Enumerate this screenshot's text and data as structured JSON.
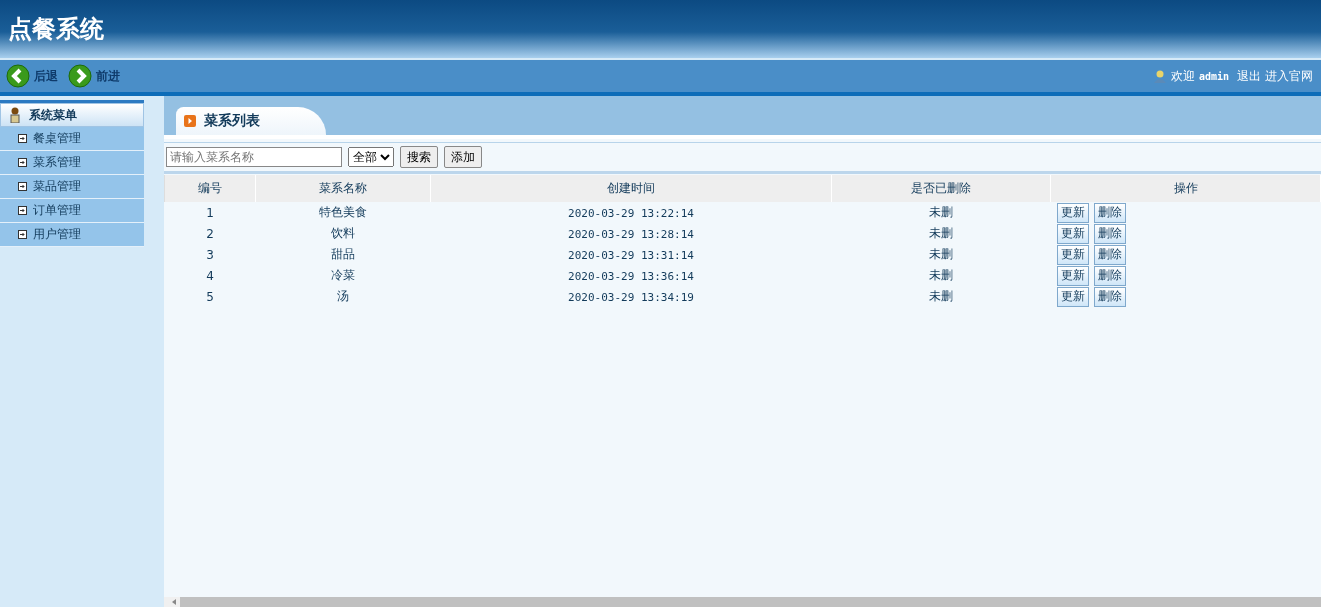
{
  "header": {
    "title": "点餐系统"
  },
  "nav": {
    "back": "后退",
    "forward": "前进",
    "welcome": "欢迎",
    "user": "admin",
    "logout": "退出",
    "site": "进入官网"
  },
  "sidebar": {
    "title": "系统菜单",
    "items": [
      {
        "label": "餐桌管理"
      },
      {
        "label": "菜系管理"
      },
      {
        "label": "菜品管理"
      },
      {
        "label": "订单管理"
      },
      {
        "label": "用户管理"
      }
    ]
  },
  "tab": {
    "label": "菜系列表"
  },
  "toolbar": {
    "search": {
      "placeholder": "请输入菜系名称"
    },
    "filter": {
      "value": "全部"
    },
    "buttons": [
      "搜索",
      "添加"
    ]
  },
  "table": {
    "columns": [
      "编号",
      "菜系名称",
      "创建时间",
      "是否已删除",
      "操作"
    ],
    "rows": [
      {
        "id": "1",
        "name": "特色美食",
        "created": "2020-03-29 13:22:14",
        "deleted": "未删",
        "actions": [
          "更新",
          "删除"
        ]
      },
      {
        "id": "2",
        "name": "饮料",
        "created": "2020-03-29 13:28:14",
        "deleted": "未删",
        "actions": [
          "更新",
          "删除"
        ]
      },
      {
        "id": "3",
        "name": "甜品",
        "created": "2020-03-29 13:31:14",
        "deleted": "未删",
        "actions": [
          "更新",
          "删除"
        ]
      },
      {
        "id": "4",
        "name": "冷菜",
        "created": "2020-03-29 13:36:14",
        "deleted": "未删",
        "actions": [
          "更新",
          "删除"
        ]
      },
      {
        "id": "5",
        "name": "汤",
        "created": "2020-03-29 13:34:19",
        "deleted": "未删",
        "actions": [
          "更新",
          "删除"
        ]
      }
    ]
  }
}
